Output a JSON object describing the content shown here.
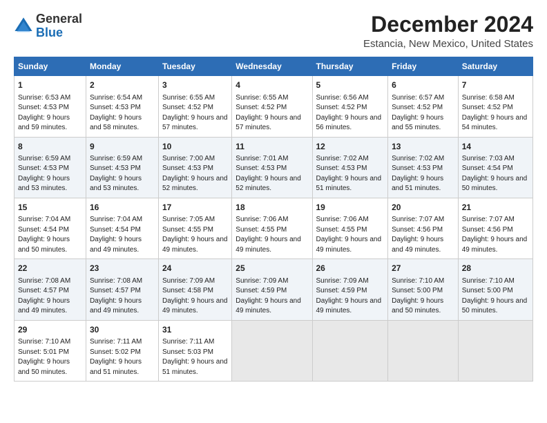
{
  "logo": {
    "general": "General",
    "blue": "Blue"
  },
  "title": "December 2024",
  "subtitle": "Estancia, New Mexico, United States",
  "days_header": [
    "Sunday",
    "Monday",
    "Tuesday",
    "Wednesday",
    "Thursday",
    "Friday",
    "Saturday"
  ],
  "weeks": [
    [
      {
        "day": "1",
        "sunrise": "Sunrise: 6:53 AM",
        "sunset": "Sunset: 4:53 PM",
        "daylight": "Daylight: 9 hours and 59 minutes."
      },
      {
        "day": "2",
        "sunrise": "Sunrise: 6:54 AM",
        "sunset": "Sunset: 4:53 PM",
        "daylight": "Daylight: 9 hours and 58 minutes."
      },
      {
        "day": "3",
        "sunrise": "Sunrise: 6:55 AM",
        "sunset": "Sunset: 4:52 PM",
        "daylight": "Daylight: 9 hours and 57 minutes."
      },
      {
        "day": "4",
        "sunrise": "Sunrise: 6:55 AM",
        "sunset": "Sunset: 4:52 PM",
        "daylight": "Daylight: 9 hours and 57 minutes."
      },
      {
        "day": "5",
        "sunrise": "Sunrise: 6:56 AM",
        "sunset": "Sunset: 4:52 PM",
        "daylight": "Daylight: 9 hours and 56 minutes."
      },
      {
        "day": "6",
        "sunrise": "Sunrise: 6:57 AM",
        "sunset": "Sunset: 4:52 PM",
        "daylight": "Daylight: 9 hours and 55 minutes."
      },
      {
        "day": "7",
        "sunrise": "Sunrise: 6:58 AM",
        "sunset": "Sunset: 4:52 PM",
        "daylight": "Daylight: 9 hours and 54 minutes."
      }
    ],
    [
      {
        "day": "8",
        "sunrise": "Sunrise: 6:59 AM",
        "sunset": "Sunset: 4:53 PM",
        "daylight": "Daylight: 9 hours and 53 minutes."
      },
      {
        "day": "9",
        "sunrise": "Sunrise: 6:59 AM",
        "sunset": "Sunset: 4:53 PM",
        "daylight": "Daylight: 9 hours and 53 minutes."
      },
      {
        "day": "10",
        "sunrise": "Sunrise: 7:00 AM",
        "sunset": "Sunset: 4:53 PM",
        "daylight": "Daylight: 9 hours and 52 minutes."
      },
      {
        "day": "11",
        "sunrise": "Sunrise: 7:01 AM",
        "sunset": "Sunset: 4:53 PM",
        "daylight": "Daylight: 9 hours and 52 minutes."
      },
      {
        "day": "12",
        "sunrise": "Sunrise: 7:02 AM",
        "sunset": "Sunset: 4:53 PM",
        "daylight": "Daylight: 9 hours and 51 minutes."
      },
      {
        "day": "13",
        "sunrise": "Sunrise: 7:02 AM",
        "sunset": "Sunset: 4:53 PM",
        "daylight": "Daylight: 9 hours and 51 minutes."
      },
      {
        "day": "14",
        "sunrise": "Sunrise: 7:03 AM",
        "sunset": "Sunset: 4:54 PM",
        "daylight": "Daylight: 9 hours and 50 minutes."
      }
    ],
    [
      {
        "day": "15",
        "sunrise": "Sunrise: 7:04 AM",
        "sunset": "Sunset: 4:54 PM",
        "daylight": "Daylight: 9 hours and 50 minutes."
      },
      {
        "day": "16",
        "sunrise": "Sunrise: 7:04 AM",
        "sunset": "Sunset: 4:54 PM",
        "daylight": "Daylight: 9 hours and 49 minutes."
      },
      {
        "day": "17",
        "sunrise": "Sunrise: 7:05 AM",
        "sunset": "Sunset: 4:55 PM",
        "daylight": "Daylight: 9 hours and 49 minutes."
      },
      {
        "day": "18",
        "sunrise": "Sunrise: 7:06 AM",
        "sunset": "Sunset: 4:55 PM",
        "daylight": "Daylight: 9 hours and 49 minutes."
      },
      {
        "day": "19",
        "sunrise": "Sunrise: 7:06 AM",
        "sunset": "Sunset: 4:55 PM",
        "daylight": "Daylight: 9 hours and 49 minutes."
      },
      {
        "day": "20",
        "sunrise": "Sunrise: 7:07 AM",
        "sunset": "Sunset: 4:56 PM",
        "daylight": "Daylight: 9 hours and 49 minutes."
      },
      {
        "day": "21",
        "sunrise": "Sunrise: 7:07 AM",
        "sunset": "Sunset: 4:56 PM",
        "daylight": "Daylight: 9 hours and 49 minutes."
      }
    ],
    [
      {
        "day": "22",
        "sunrise": "Sunrise: 7:08 AM",
        "sunset": "Sunset: 4:57 PM",
        "daylight": "Daylight: 9 hours and 49 minutes."
      },
      {
        "day": "23",
        "sunrise": "Sunrise: 7:08 AM",
        "sunset": "Sunset: 4:57 PM",
        "daylight": "Daylight: 9 hours and 49 minutes."
      },
      {
        "day": "24",
        "sunrise": "Sunrise: 7:09 AM",
        "sunset": "Sunset: 4:58 PM",
        "daylight": "Daylight: 9 hours and 49 minutes."
      },
      {
        "day": "25",
        "sunrise": "Sunrise: 7:09 AM",
        "sunset": "Sunset: 4:59 PM",
        "daylight": "Daylight: 9 hours and 49 minutes."
      },
      {
        "day": "26",
        "sunrise": "Sunrise: 7:09 AM",
        "sunset": "Sunset: 4:59 PM",
        "daylight": "Daylight: 9 hours and 49 minutes."
      },
      {
        "day": "27",
        "sunrise": "Sunrise: 7:10 AM",
        "sunset": "Sunset: 5:00 PM",
        "daylight": "Daylight: 9 hours and 50 minutes."
      },
      {
        "day": "28",
        "sunrise": "Sunrise: 7:10 AM",
        "sunset": "Sunset: 5:00 PM",
        "daylight": "Daylight: 9 hours and 50 minutes."
      }
    ],
    [
      {
        "day": "29",
        "sunrise": "Sunrise: 7:10 AM",
        "sunset": "Sunset: 5:01 PM",
        "daylight": "Daylight: 9 hours and 50 minutes."
      },
      {
        "day": "30",
        "sunrise": "Sunrise: 7:11 AM",
        "sunset": "Sunset: 5:02 PM",
        "daylight": "Daylight: 9 hours and 51 minutes."
      },
      {
        "day": "31",
        "sunrise": "Sunrise: 7:11 AM",
        "sunset": "Sunset: 5:03 PM",
        "daylight": "Daylight: 9 hours and 51 minutes."
      },
      null,
      null,
      null,
      null
    ]
  ]
}
